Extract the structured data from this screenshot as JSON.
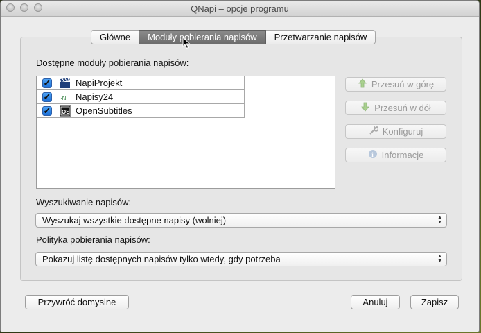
{
  "window": {
    "title": "QNapi – opcje programu"
  },
  "tabs": [
    {
      "label": "Główne",
      "active": false
    },
    {
      "label": "Moduły pobierania napisów",
      "active": true
    },
    {
      "label": "Przetwarzanie napisów",
      "active": false
    }
  ],
  "modules": {
    "heading": "Dostępne moduły pobierania napisów:",
    "items": [
      {
        "label": "NapiProjekt",
        "checked": true,
        "icon": "clapperboard-icon"
      },
      {
        "label": "Napisy24",
        "checked": true,
        "icon": "napisy24-icon"
      },
      {
        "label": "OpenSubtitles",
        "checked": true,
        "icon": "opensubtitles-icon"
      }
    ]
  },
  "side_buttons": {
    "move_up": "Przesuń w górę",
    "move_down": "Przesuń w dół",
    "configure": "Konfiguruj",
    "info": "Informacje"
  },
  "search": {
    "label": "Wyszukiwanie napisów:",
    "value": "Wyszukaj wszystkie dostępne napisy (wolniej)"
  },
  "policy": {
    "label": "Polityka pobierania napisów:",
    "value": "Pokazuj listę dostępnych napisów tylko wtedy, gdy potrzeba"
  },
  "footer": {
    "restore": "Przywróć domyslne",
    "cancel": "Anuluj",
    "save": "Zapisz"
  },
  "colors": {
    "checkbox": "#2f7de3",
    "active_tab": "#7a7a7a",
    "disabled_text": "#9a9a9a"
  }
}
